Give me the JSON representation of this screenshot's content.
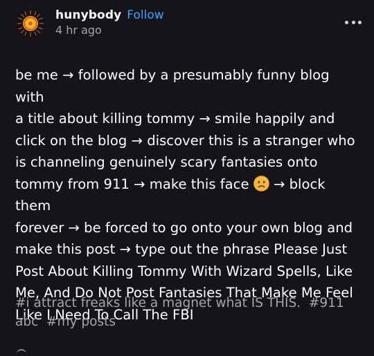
{
  "post": {
    "blog_name": "hunybody",
    "follow_label": "Follow",
    "timestamp": "4 hr ago",
    "body_lines": [
      "be me → followed by a presumably funny blog with",
      "a title about killing tommy → smile happily and",
      "click on the blog → discover this is a stranger who",
      "is channeling genuinely scary fantasies onto",
      "tommy from 911 → make this face",
      " → block them",
      "forever → be forced to go onto your own blog and",
      "make this post → type out the phrase Please Just",
      "Post About Killing Tommy With Wizard Spells, Like",
      "Me, And Do Not Post Fantasies That Make Me Feel",
      "Like I Need To Call The FBI"
    ],
    "tags": {
      "tag1": "#i attract freaks like a magnet what IS THIS.",
      "tag2a": "#911",
      "tag2b": "abc",
      "tag3": "#my posts"
    },
    "icons": {
      "avatar": "sun-avatar-icon",
      "menu": "more-horizontal-icon",
      "emoji": "frowning-face-emoji"
    },
    "colors": {
      "background": "#16141a",
      "text": "#ffffff",
      "follow": "#35a6ff",
      "muted": "#a6a3ad",
      "emoji_face": "#f6b73c"
    }
  }
}
